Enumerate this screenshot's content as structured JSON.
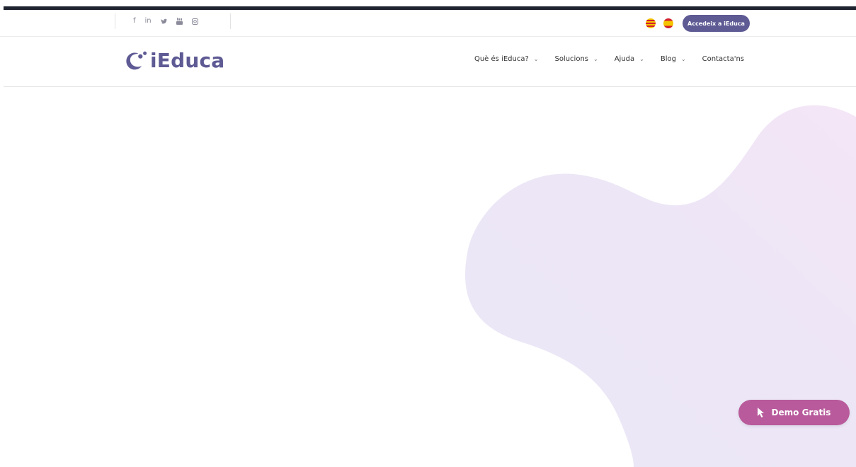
{
  "social": {
    "icons": [
      "facebook-icon",
      "linkedin-icon",
      "twitter-icon",
      "youtube-icon",
      "instagram-icon"
    ],
    "labels": {
      "facebook": "f",
      "linkedin": "in"
    }
  },
  "languages": [
    "catalan-flag",
    "spanish-flag"
  ],
  "access_button": "Accedeix a iEduca",
  "logo": {
    "text": "iEduca"
  },
  "nav": [
    {
      "label": "Què és iEduca?",
      "has_dropdown": true
    },
    {
      "label": "Solucions",
      "has_dropdown": true
    },
    {
      "label": "Ajuda",
      "has_dropdown": true
    },
    {
      "label": "Blog",
      "has_dropdown": true
    },
    {
      "label": "Contacta'ns",
      "has_dropdown": false
    }
  ],
  "demo_button": "Demo Gratis",
  "colors": {
    "brand": "#5e5a94",
    "demo": "#b85a9b",
    "blob_light": "#ebe8f7",
    "blob_pink": "#f4e6f6"
  }
}
